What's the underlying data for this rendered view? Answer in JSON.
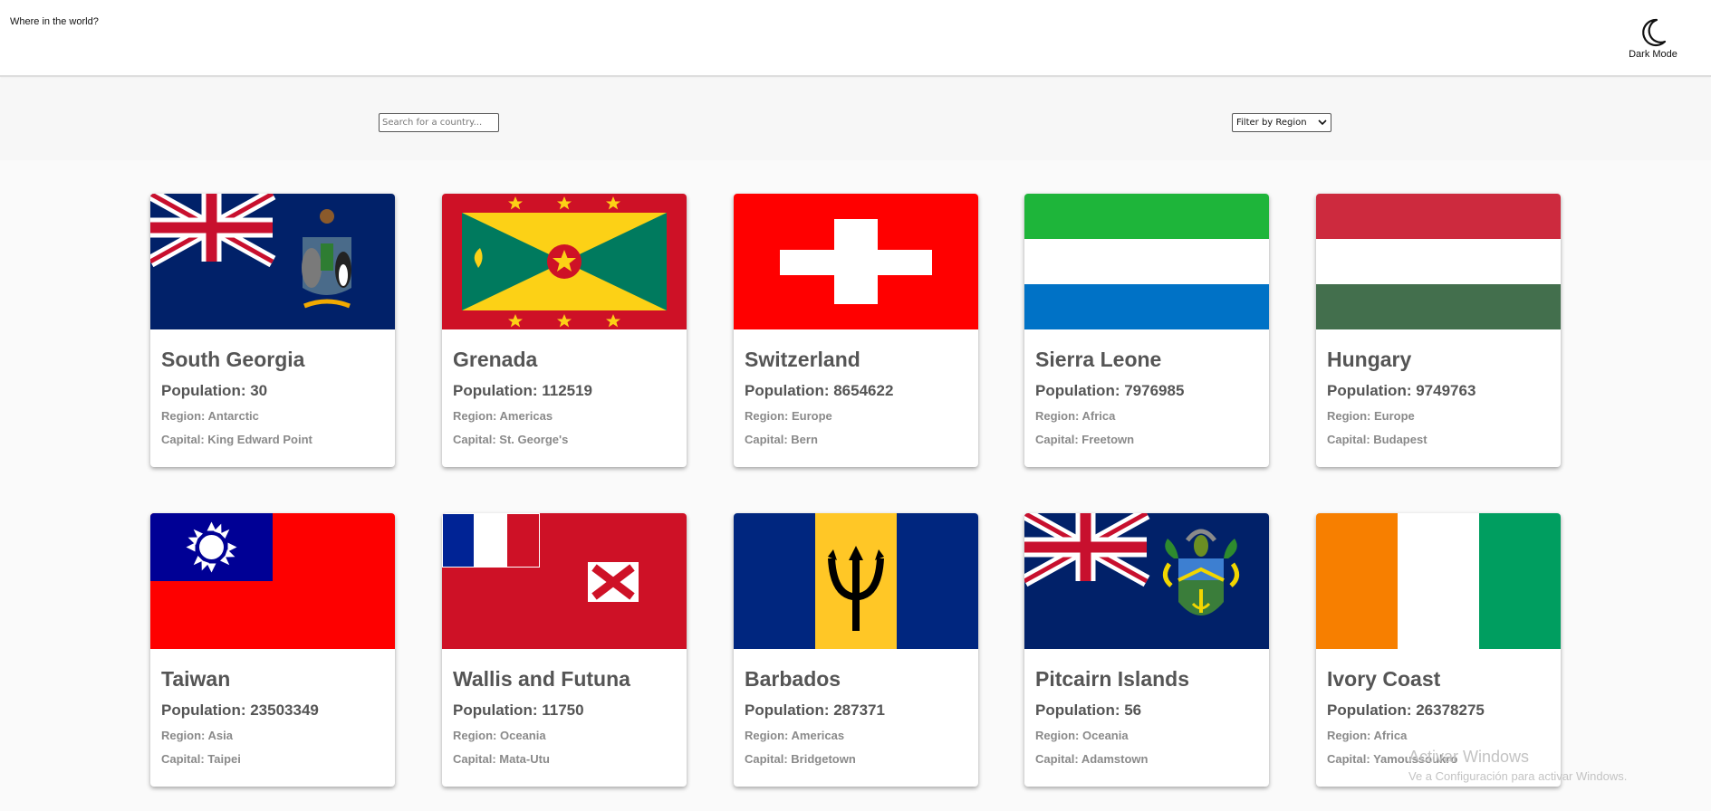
{
  "header": {
    "title": "Where in the world?",
    "dark_mode_label": "Dark Mode"
  },
  "search": {
    "placeholder": "Search for a country..."
  },
  "filter": {
    "selected": "Filter by Region"
  },
  "labels": {
    "population": "Population: ",
    "region": "Region: ",
    "capital": "Capital: "
  },
  "countries": [
    {
      "name": "South Georgia",
      "population": "30",
      "region": "Antarctic",
      "capital": "King Edward Point",
      "flag": "south-georgia-flag"
    },
    {
      "name": "Grenada",
      "population": "112519",
      "region": "Americas",
      "capital": "St. George's",
      "flag": "grenada-flag"
    },
    {
      "name": "Switzerland",
      "population": "8654622",
      "region": "Europe",
      "capital": "Bern",
      "flag": "switzerland-flag"
    },
    {
      "name": "Sierra Leone",
      "population": "7976985",
      "region": "Africa",
      "capital": "Freetown",
      "flag": "sierra-leone-flag"
    },
    {
      "name": "Hungary",
      "population": "9749763",
      "region": "Europe",
      "capital": "Budapest",
      "flag": "hungary-flag"
    },
    {
      "name": "Taiwan",
      "population": "23503349",
      "region": "Asia",
      "capital": "Taipei",
      "flag": "taiwan-flag"
    },
    {
      "name": "Wallis and Futuna",
      "population": "11750",
      "region": "Oceania",
      "capital": "Mata-Utu",
      "flag": "wallis-futuna-flag"
    },
    {
      "name": "Barbados",
      "population": "287371",
      "region": "Americas",
      "capital": "Bridgetown",
      "flag": "barbados-flag"
    },
    {
      "name": "Pitcairn Islands",
      "population": "56",
      "region": "Oceania",
      "capital": "Adamstown",
      "flag": "pitcairn-flag"
    },
    {
      "name": "Ivory Coast",
      "population": "26378275",
      "region": "Africa",
      "capital": "Yamoussoukro",
      "flag": "ivory-coast-flag"
    }
  ],
  "watermark": {
    "line1": "Activar Windows",
    "line2": "Ve a Configuración para activar Windows."
  },
  "colors": {
    "background": "#fafafa",
    "card_text": "#555555",
    "card_subtext": "#8a8a8a"
  },
  "icons": {
    "dark_mode": "moon-icon",
    "filter_caret": "chevron-down-icon"
  }
}
